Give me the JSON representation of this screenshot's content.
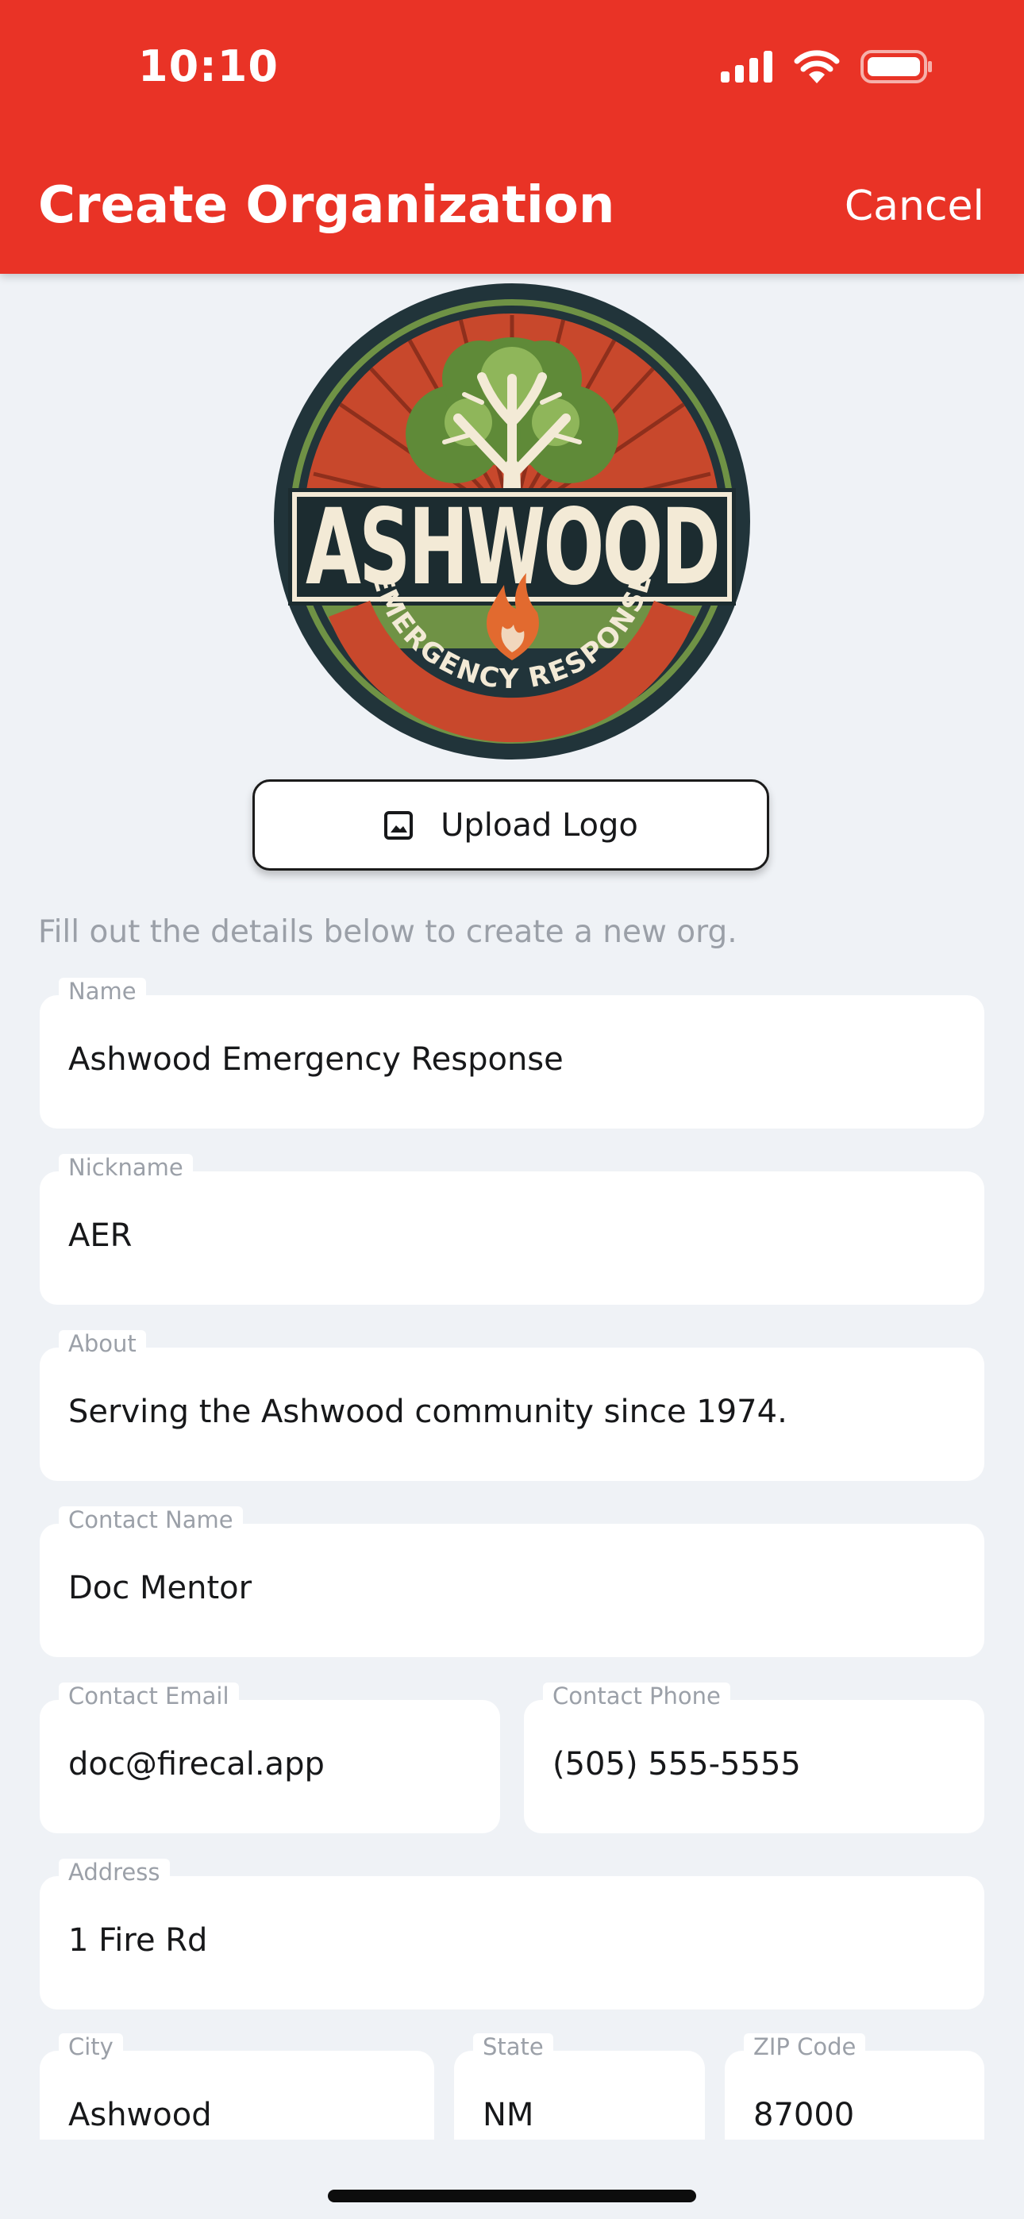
{
  "status_bar": {
    "time": "10:10"
  },
  "header": {
    "title": "Create Organization",
    "cancel_label": "Cancel"
  },
  "logo": {
    "alt": "Ashwood Emergency Response logo",
    "word": "ASHWOOD",
    "subtitle": "EMERGENCY RESPONSE",
    "colors": {
      "ring": "#21343a",
      "sunburst": "#c8482c",
      "green": "#6f9245",
      "cream": "#f3ead6",
      "flame": "#e26a2f"
    }
  },
  "upload": {
    "label": "Upload Logo",
    "icon": "image-icon"
  },
  "instructions": "Fill out the details below to create a new org.",
  "form": {
    "name": {
      "label": "Name",
      "value": "Ashwood Emergency Response"
    },
    "nickname": {
      "label": "Nickname",
      "value": "AER"
    },
    "about": {
      "label": "About",
      "value": "Serving the Ashwood community since 1974."
    },
    "contact_name": {
      "label": "Contact Name",
      "value": "Doc Mentor"
    },
    "contact_email": {
      "label": "Contact Email",
      "value": "doc@firecal.app"
    },
    "contact_phone": {
      "label": "Contact Phone",
      "value": "(505) 555-5555"
    },
    "address": {
      "label": "Address",
      "value": "1 Fire Rd"
    },
    "city": {
      "label": "City",
      "value": "Ashwood"
    },
    "state": {
      "label": "State",
      "value": "NM"
    },
    "zip": {
      "label": "ZIP Code",
      "value": "87000"
    }
  },
  "colors": {
    "accent": "#e93326",
    "background": "#eff2f6",
    "label_gray": "#9ba0a8"
  }
}
